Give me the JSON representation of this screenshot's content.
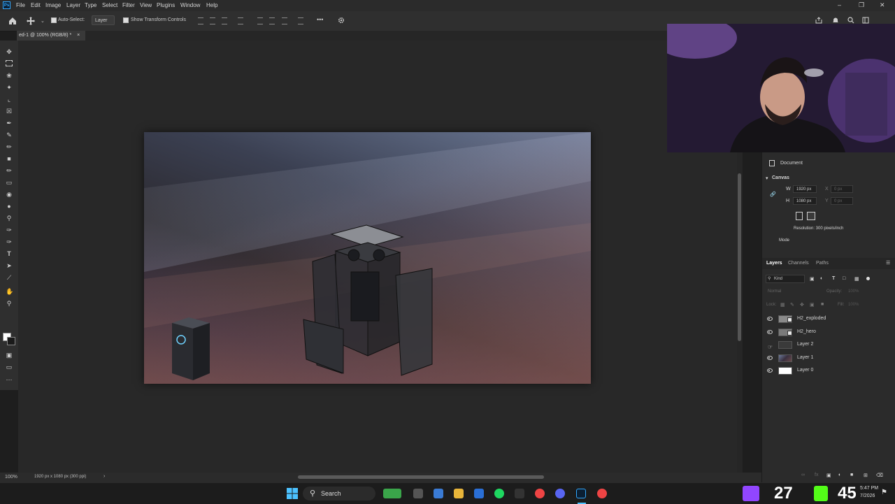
{
  "app": {
    "logo": "Ps",
    "menu": [
      "File",
      "Edit",
      "Image",
      "Layer",
      "Type",
      "Select",
      "Filter",
      "View",
      "Plugins",
      "Window",
      "Help"
    ],
    "window_controls": {
      "minimize": "–",
      "maximize": "❐",
      "close": "✕"
    }
  },
  "options_bar": {
    "auto_select_label": "Auto-Select:",
    "auto_select_value": "Layer",
    "transform_controls_label": "Show Transform Controls",
    "more": "•••"
  },
  "document": {
    "tab_title": "ed-1 @ 100% (RGB/8) *",
    "tab_close": "×"
  },
  "status": {
    "zoom": "100%",
    "doc_info": "1920 px x 1080 px (300 ppi)",
    "arrow": "›"
  },
  "properties": {
    "document_label": "Document",
    "canvas_section": "Canvas",
    "w_label": "W",
    "w_value": "1920 px",
    "h_label": "H",
    "h_value": "1080 px",
    "x_label": "X",
    "x_value": "0 px",
    "y_label": "Y",
    "y_value": "0 px",
    "resolution": "Resolution: 300 pixels/inch",
    "mode_label": "Mode"
  },
  "layers_panel": {
    "tabs": [
      "Layers",
      "Channels",
      "Paths"
    ],
    "kind_label": "Kind",
    "blend_mode": "Normal",
    "opacity_label": "Opacity:",
    "opacity_value": "100%",
    "lock_label": "Lock:",
    "fill_label": "Fill:",
    "fill_value": "100%",
    "layers": [
      {
        "name": "H2_exploded",
        "visible": true,
        "smart": true,
        "thumb": "#8a8a8a"
      },
      {
        "name": "H2_hero",
        "visible": true,
        "smart": true,
        "thumb": "#7a7a7a"
      },
      {
        "name": "Layer 2",
        "visible": false,
        "smart": false,
        "thumb": "#3a3a3a"
      },
      {
        "name": "Layer 1",
        "visible": true,
        "smart": false,
        "thumb": "#5a5870"
      },
      {
        "name": "Layer 0",
        "visible": true,
        "smart": false,
        "thumb": "#ffffff"
      }
    ]
  },
  "taskbar": {
    "search_label": "Search",
    "time": "5:47 PM",
    "date": "7/2026",
    "overlay_left": "27",
    "overlay_right": "45"
  },
  "colors": {
    "accent": "#31a8ff",
    "panel_bg": "#2b2b2b",
    "workspace_bg": "#282828"
  }
}
